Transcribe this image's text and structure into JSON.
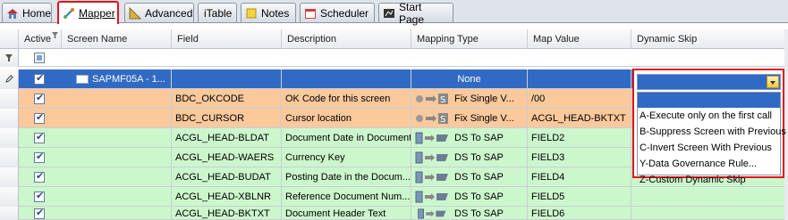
{
  "tabs": [
    {
      "label": "Home",
      "icon": "home-icon"
    },
    {
      "label": "Mapper",
      "icon": "mapper-icon",
      "active": true
    },
    {
      "label": "Advanced",
      "icon": "advanced-icon"
    },
    {
      "label": "iTable",
      "icon": "table-icon"
    },
    {
      "label": "Notes",
      "icon": "notes-icon"
    },
    {
      "label": "Scheduler",
      "icon": "scheduler-icon"
    },
    {
      "label": "Start Page",
      "icon": "start-page-icon"
    }
  ],
  "columns": {
    "active": "Active",
    "screen_name": "Screen Name",
    "field": "Field",
    "description": "Description",
    "mapping_type": "Mapping Type",
    "map_value": "Map Value",
    "dynamic_skip": "Dynamic Skip"
  },
  "selected_row": {
    "screen_name": "SAPMF05A - 1...",
    "mapping_type": "None"
  },
  "rows": [
    {
      "field": "BDC_OKCODE",
      "description": "OK Code for this screen",
      "mapping_type": "Fix Single V...",
      "map_value": "/00",
      "kind": "orange"
    },
    {
      "field": "BDC_CURSOR",
      "description": "Cursor location",
      "mapping_type": "Fix Single V...",
      "map_value": "ACGL_HEAD-BKTXT",
      "kind": "orange"
    },
    {
      "field": "ACGL_HEAD-BLDAT",
      "description": "Document Date in Document",
      "mapping_type": "DS To SAP",
      "map_value": "FIELD2",
      "kind": "green"
    },
    {
      "field": "ACGL_HEAD-WAERS",
      "description": "Currency Key",
      "mapping_type": "DS To SAP",
      "map_value": "FIELD3",
      "kind": "green"
    },
    {
      "field": "ACGL_HEAD-BUDAT",
      "description": "Posting Date in the Docum...",
      "mapping_type": "DS To SAP",
      "map_value": "FIELD4",
      "kind": "green"
    },
    {
      "field": "ACGL_HEAD-XBLNR",
      "description": "Reference Document Num...",
      "mapping_type": "DS To SAP",
      "map_value": "FIELD5",
      "kind": "green"
    },
    {
      "field": "ACGL_HEAD-BKTXT",
      "description": "Document Header Text",
      "mapping_type": "DS To SAP",
      "map_value": "FIELD6",
      "kind": "green"
    }
  ],
  "dynamic_skip_options": [
    "A-Execute only on the first call",
    "B-Suppress Screen with Previous",
    "C-Invert Screen With Previous",
    "Y-Data Governance Rule...",
    "Z-Custom Dynamic Skip"
  ],
  "colors": {
    "selected": "#316ac5",
    "orange_row": "#fbc99c",
    "green_row": "#ccf7cc",
    "highlight_border": "#e0141e"
  }
}
